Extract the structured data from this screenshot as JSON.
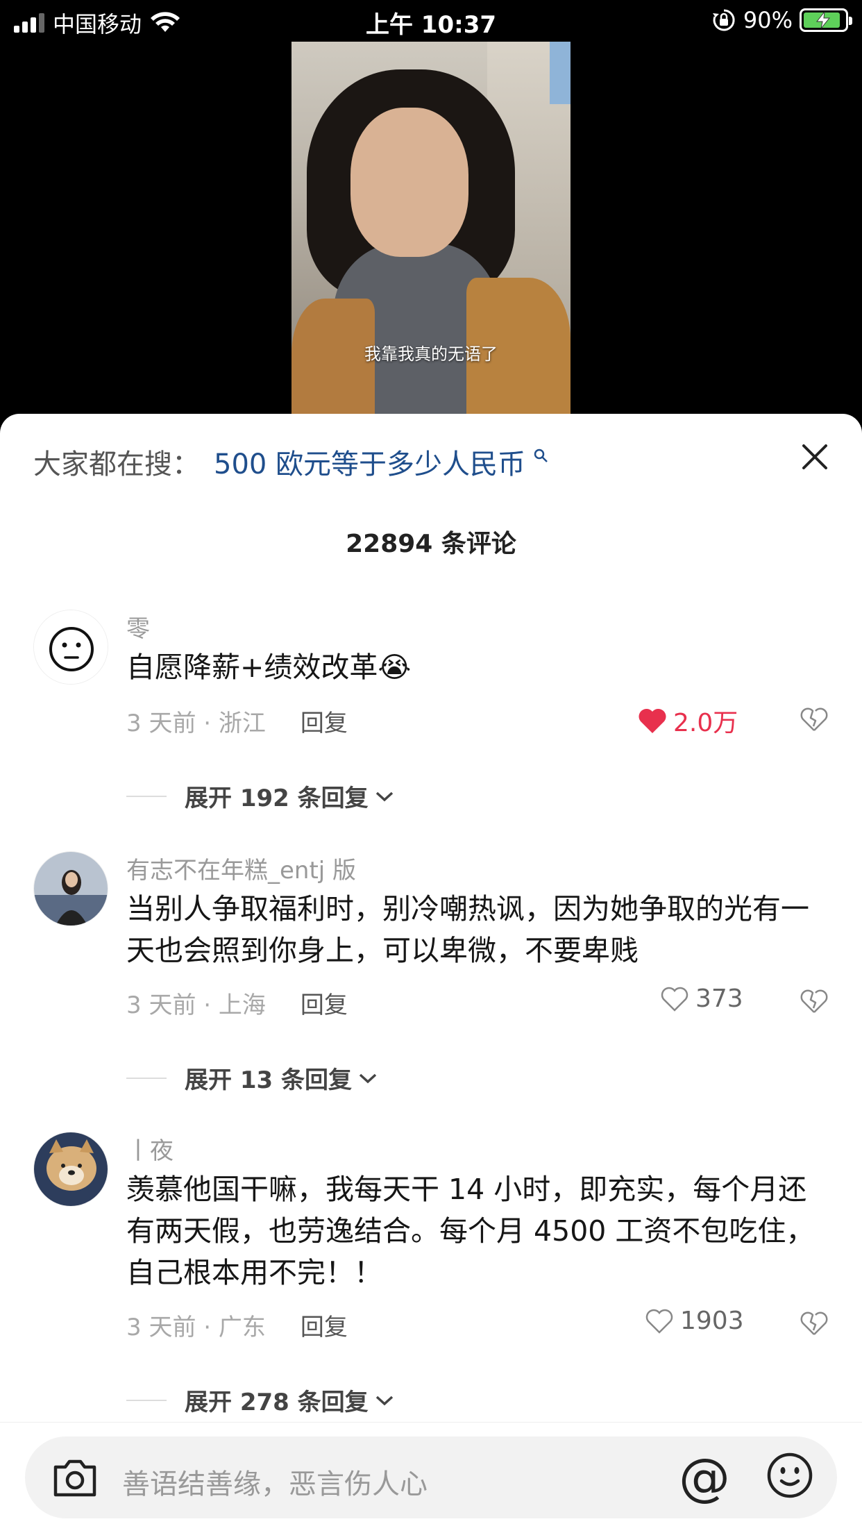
{
  "status_bar": {
    "carrier": "中国移动",
    "time": "上午 10:37",
    "battery_percent": "90%",
    "battery_level": 0.9
  },
  "video": {
    "subtitle": "我靠我真的无语了"
  },
  "sheet": {
    "search_prefix": "大家都在搜：",
    "search_query": "500 欧元等于多少人民币",
    "comment_count": "22894 条评论"
  },
  "comments": [
    {
      "username": "零",
      "text": "自愿降薪+绩效改革",
      "emoji": "😭",
      "time_location": "3 天前 · 浙江",
      "reply_label": "回复",
      "likes": "2.0万",
      "liked": true,
      "expand_label": "展开 192 条回复"
    },
    {
      "username": "有志不在年糕_entj 版",
      "text": "当别人争取福利时，别冷嘲热讽，因为她争取的光有一天也会照到你身上，可以卑微，不要卑贱",
      "time_location": "3 天前 · 上海",
      "reply_label": "回复",
      "likes": "373",
      "liked": false,
      "expand_label": "展开 13 条回复"
    },
    {
      "username": "丨夜",
      "text": "羡慕他国干嘛，我每天干 14 小时，即充实，每个月还有两天假，也劳逸结合。每个月 4500 工资不包吃住，自己根本用不完！！",
      "time_location": "3 天前 · 广东",
      "reply_label": "回复",
      "likes": "1903",
      "liked": false,
      "expand_label": "展开 278 条回复"
    }
  ],
  "input_bar": {
    "placeholder": "善语结善缘，恶言伤人心",
    "at_symbol": "@"
  },
  "colors": {
    "link_blue": "#1f4e8c",
    "like_red": "#e8304d"
  }
}
